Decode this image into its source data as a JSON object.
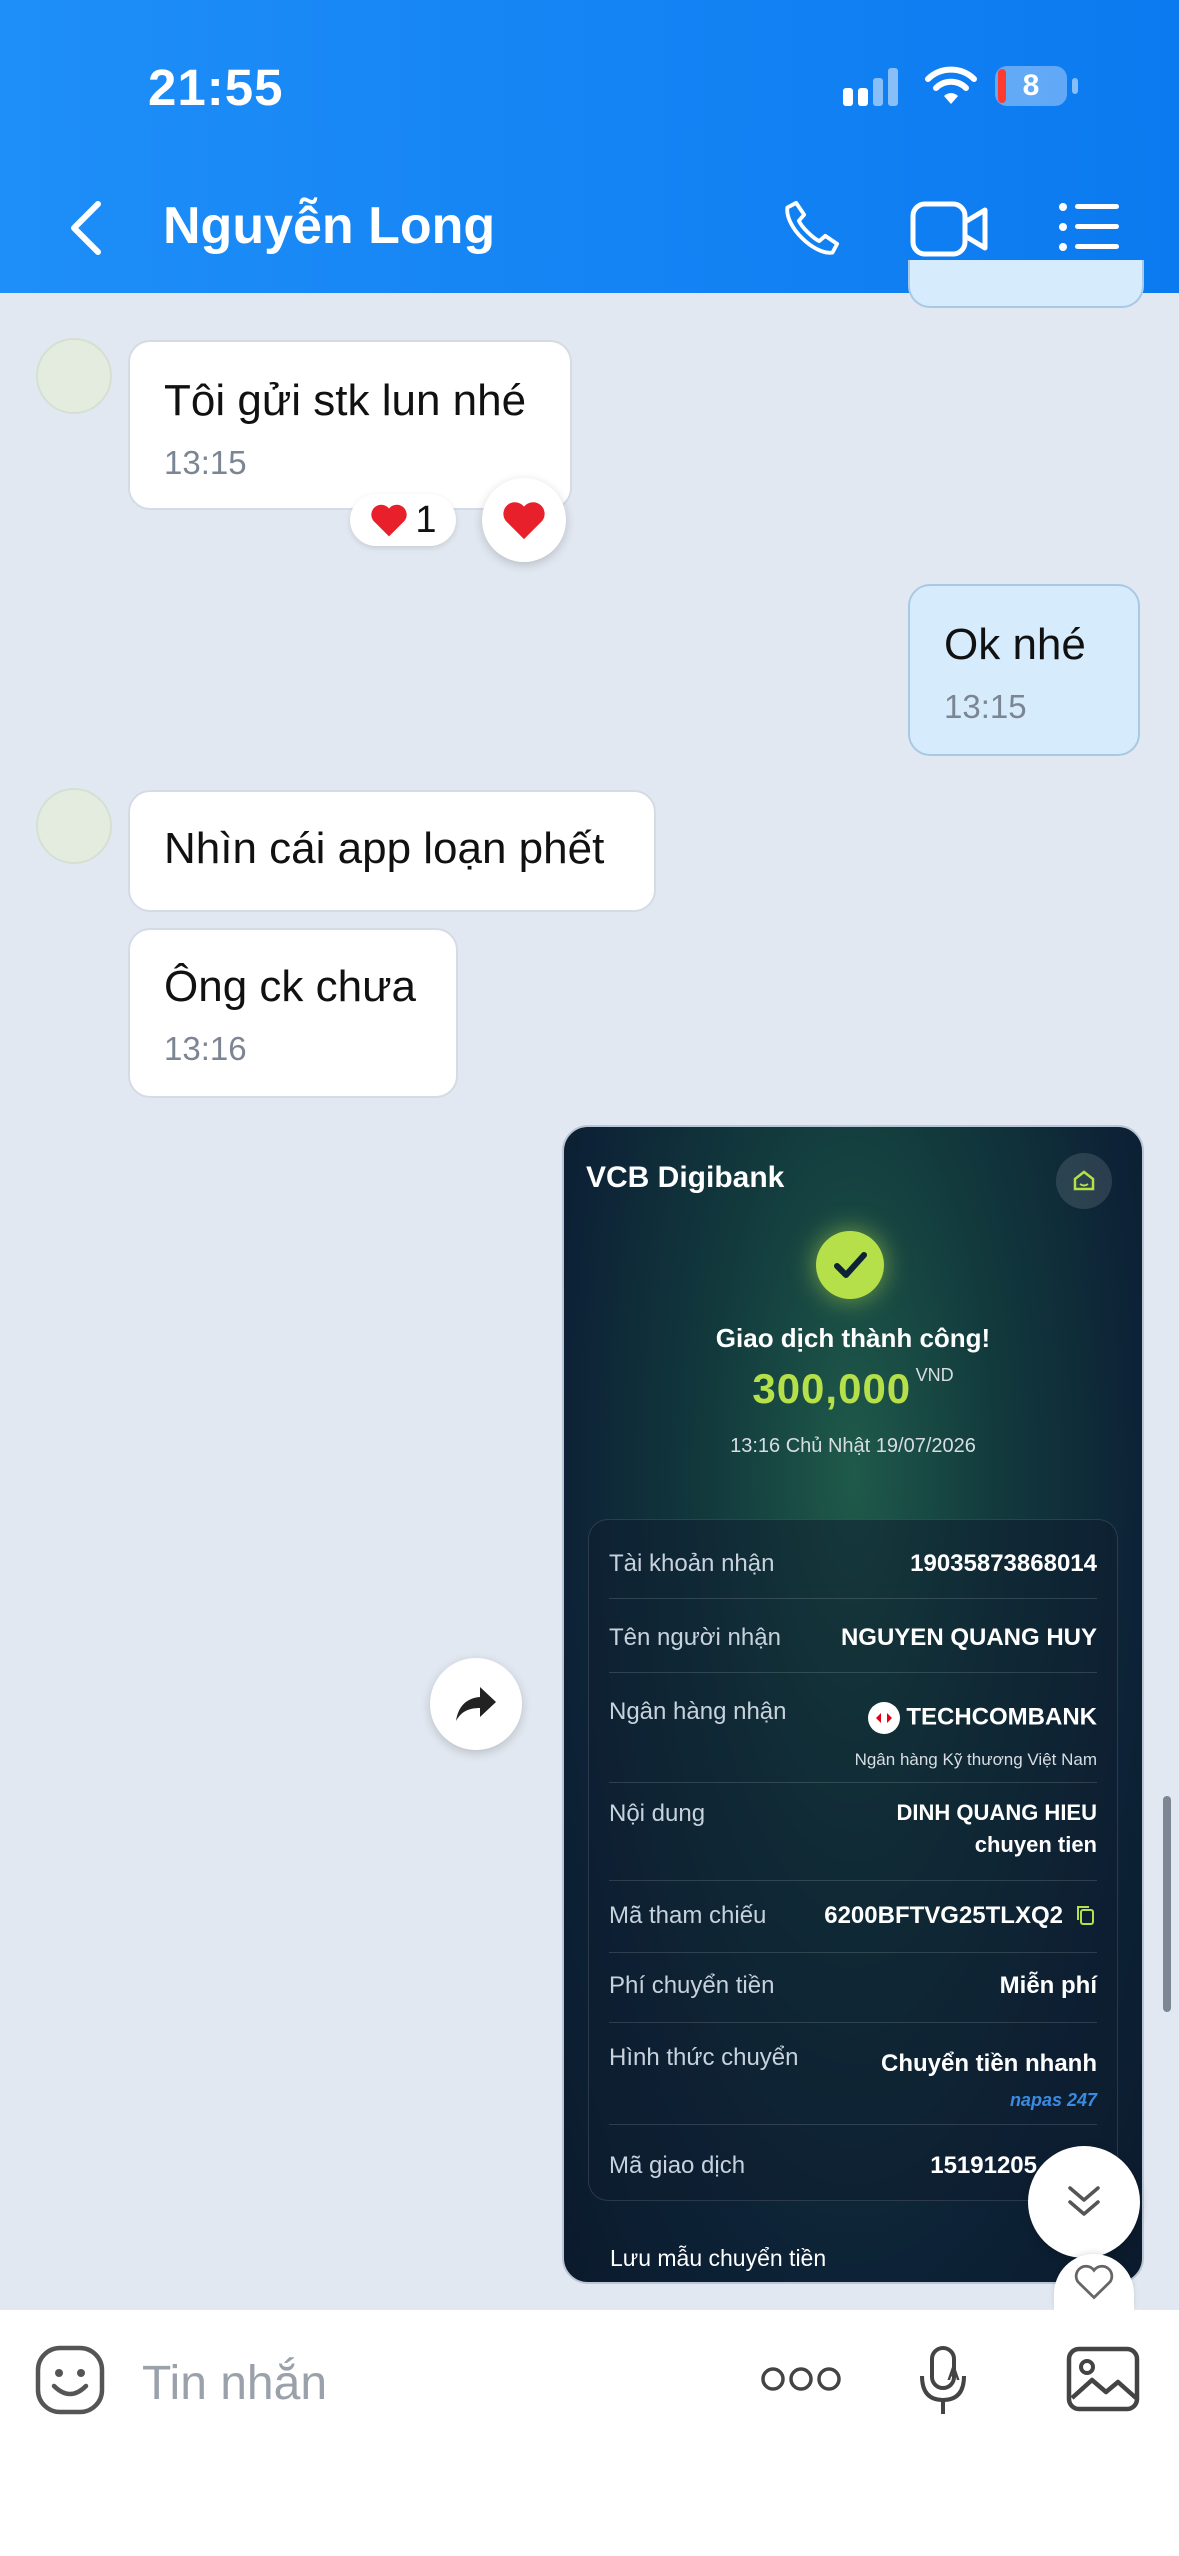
{
  "status_bar": {
    "time": "21:55",
    "battery": "8"
  },
  "header": {
    "contact_name": "Nguyễn Long"
  },
  "messages": [
    {
      "text": "Tôi gửi stk lun nhé",
      "time": "13:15",
      "reaction_count": "1"
    },
    {
      "text": "Ok nhé",
      "time": "13:15"
    },
    {
      "text": "Nhìn cái app loạn phết"
    },
    {
      "text": "Ông ck chưa",
      "time": "13:16"
    }
  ],
  "receipt": {
    "brand": "VCB Digibank",
    "status": "Giao dịch thành công!",
    "amount": "300,000",
    "currency": "VND",
    "datetime": "13:16 Chủ Nhật 19/07/2026",
    "rows": [
      {
        "label": "Tài khoản nhận",
        "value": "19035873868014"
      },
      {
        "label": "Tên người nhận",
        "value": "NGUYEN QUANG HUY"
      },
      {
        "label": "Ngân hàng nhận",
        "value": "TECHCOMBANK",
        "sub": "Ngân hàng Kỹ thương Việt Nam"
      },
      {
        "label": "Nội dung",
        "value": "DINH QUANG HIEU",
        "value2": "chuyen tien"
      },
      {
        "label": "Mã tham chiếu",
        "value": "6200BFTVG25TLXQ2"
      },
      {
        "label": "Phí chuyển tiền",
        "value": "Miễn phí"
      },
      {
        "label": "Hình thức chuyển",
        "value": "Chuyển tiền nhanh",
        "sub": "napas 247"
      },
      {
        "label": "Mã giao dịch",
        "value": "15191205"
      }
    ],
    "save_template": "Lưu mẫu chuyển tiền"
  },
  "input": {
    "placeholder": "Tin nhắn"
  },
  "colors": {
    "header": "#0b7af0",
    "accent_green": "#b6e04a",
    "heart": "#e8202c"
  },
  "icons": [
    "back-icon",
    "phone-icon",
    "video-icon",
    "menu-icon",
    "share-icon",
    "heart-icon",
    "scroll-down-icon",
    "sticker-icon",
    "more-icon",
    "voice-icon",
    "image-icon"
  ]
}
